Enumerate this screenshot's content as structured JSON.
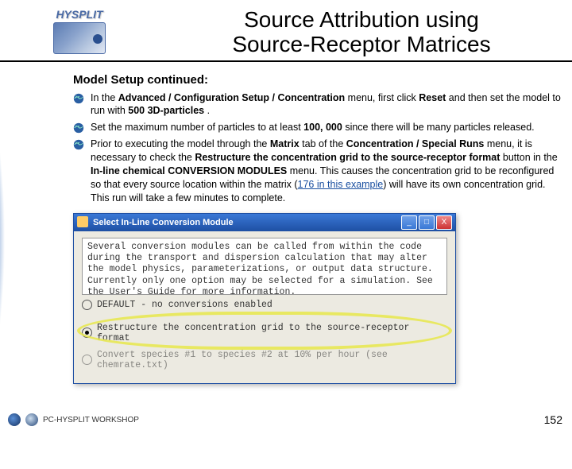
{
  "header": {
    "product_name": "HYSPLIT",
    "title_line1": "Source Attribution using",
    "title_line2": "Source-Receptor Matrices"
  },
  "section": {
    "heading": "Model Setup continued:",
    "items": [
      {
        "html": "In the <b>Advanced / Configuration Setup / Concentration</b> menu, first click <b>Reset</b> and then set the model  to run with <b>500 3D-particles</b> ."
      },
      {
        "html": "Set the maximum number of particles to at least <b>100, 000</b> since there will be many particles released."
      },
      {
        "html": "Prior to executing the model through the <b>Matrix</b> tab of the <b>Concentration / Special Runs</b> menu, it is necessary to check the <b>Restructure the concentration grid to the source-receptor format</b> button in the <b>In-line chemical CONVERSION MODULES</b> menu. This causes the concentration grid to be reconfigured so that every source location within the matrix (<a href='#'>176 in this example</a>) will have its own concentration grid. This run will take a few minutes to complete."
      }
    ]
  },
  "dialog": {
    "title": "Select In-Line Conversion Module",
    "help_text": "Several conversion modules can be called from within the code during the transport and dispersion calculation that may alter the model physics, parameterizations, or output data structure. Currently only one option may be selected for a simulation. See the User's Guide for more information.",
    "opt_default": "DEFAULT - no conversions enabled",
    "opt_restructure": "Restructure the concentration grid to the source-receptor format",
    "opt_convert": "Convert species #1 to species #2 at 10% per hour (see chemrate.txt)",
    "min_icon": "_",
    "max_icon": "□",
    "close_icon": "X"
  },
  "footer": {
    "workshop": "PC-HYSPLIT WORKSHOP",
    "page": "152"
  }
}
